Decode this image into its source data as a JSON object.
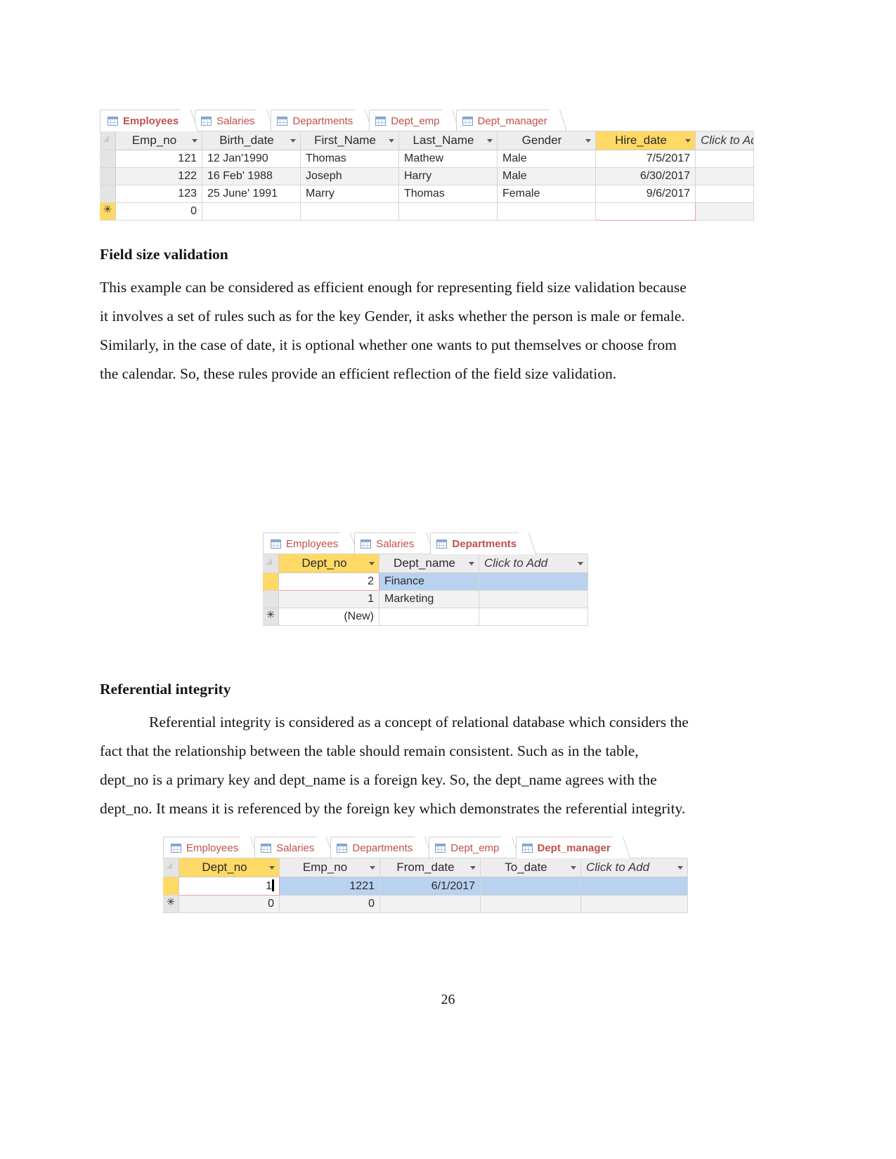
{
  "page": {
    "number": "26"
  },
  "table_employees": {
    "tabs": [
      {
        "label": "Employees",
        "active": true
      },
      {
        "label": "Salaries",
        "active": false
      },
      {
        "label": "Departments",
        "active": false
      },
      {
        "label": "Dept_emp",
        "active": false
      },
      {
        "label": "Dept_manager",
        "active": false
      }
    ],
    "columns": [
      "Emp_no",
      "Birth_date",
      "First_Name",
      "Last_Name",
      "Gender",
      "Hire_date",
      "Click to Add"
    ],
    "key_column": "Hire_date",
    "rows": [
      {
        "Emp_no": "121",
        "Birth_date": "12 Jan'1990",
        "First_Name": "Thomas",
        "Last_Name": "Mathew",
        "Gender": "Male",
        "Hire_date": "7/5/2017"
      },
      {
        "Emp_no": "122",
        "Birth_date": "16 Feb' 1988",
        "First_Name": "Joseph",
        "Last_Name": "Harry",
        "Gender": "Male",
        "Hire_date": "6/30/2017"
      },
      {
        "Emp_no": "123",
        "Birth_date": "25 June' 1991",
        "First_Name": "Marry",
        "Last_Name": "Thomas",
        "Gender": "Female",
        "Hire_date": "9/6/2017"
      }
    ],
    "new_row": {
      "marker": "✳",
      "Emp_no": "0",
      "Birth_date": "",
      "First_Name": "",
      "Last_Name": "",
      "Gender": "",
      "Hire_date": ""
    }
  },
  "heading_field_size": "Field size validation",
  "para_field_size": {
    "lines": [
      "This example can be considered as efficient enough for representing field size validation because",
      "it involves a set of rules such as for the key Gender, it asks whether the person is male or female.",
      "Similarly, in the case of date, it is optional whether one wants to put themselves or choose from",
      "the calendar. So, these rules provide an efficient reflection of the field size validation."
    ]
  },
  "table_departments": {
    "tabs": [
      {
        "label": "Employees",
        "active": false
      },
      {
        "label": "Salaries",
        "active": false
      },
      {
        "label": "Departments",
        "active": true
      }
    ],
    "columns": [
      "Dept_no",
      "Dept_name",
      "Click to Add"
    ],
    "key_column": "Dept_no",
    "rows": [
      {
        "Dept_no": "2",
        "Dept_name": "Finance",
        "selected": true
      },
      {
        "Dept_no": "1",
        "Dept_name": "Marketing",
        "selected": false
      }
    ],
    "new_row": {
      "marker": "✳",
      "Dept_no": "(New)",
      "Dept_name": ""
    }
  },
  "heading_referential": "Referential integrity",
  "para_referential": {
    "lines": [
      {
        "text": "Referential integrity is considered as a concept of relational database which considers the",
        "indent": true,
        "justify": false
      },
      {
        "text": "fact  that  the  relationship  between  the  table  should  remain  consistent.  Such  as  in  the  table,",
        "indent": false,
        "justify": false
      },
      {
        "text": "dept_no  is  a  primary  key  and  dept_name  is   a  foreign  key.  So,  the  dept_name  agrees  with  the",
        "indent": false,
        "justify": false
      },
      {
        "text": "dept_no. It means it is referenced by the foreign key which demonstrates the referential integrity.",
        "indent": false,
        "justify": false
      }
    ]
  },
  "table_dept_manager": {
    "tabs": [
      {
        "label": "Employees",
        "active": false
      },
      {
        "label": "Salaries",
        "active": false
      },
      {
        "label": "Departments",
        "active": false
      },
      {
        "label": "Dept_emp",
        "active": false
      },
      {
        "label": "Dept_manager",
        "active": true
      }
    ],
    "columns": [
      "Dept_no",
      "Emp_no",
      "From_date",
      "To_date",
      "Click to Add"
    ],
    "key_column": "Dept_no",
    "rows": [
      {
        "Dept_no": "1",
        "Emp_no": "1221",
        "From_date": "6/1/2017",
        "To_date": "",
        "editing": true
      }
    ],
    "new_row": {
      "marker": "✳",
      "Dept_no": "0",
      "Emp_no": "0",
      "From_date": "",
      "To_date": ""
    }
  },
  "colors": {
    "key_header": "#ffd966",
    "selection": "#b8d2f0",
    "tab_text": "#c0504d",
    "edit_border": "#f2a0a0"
  }
}
